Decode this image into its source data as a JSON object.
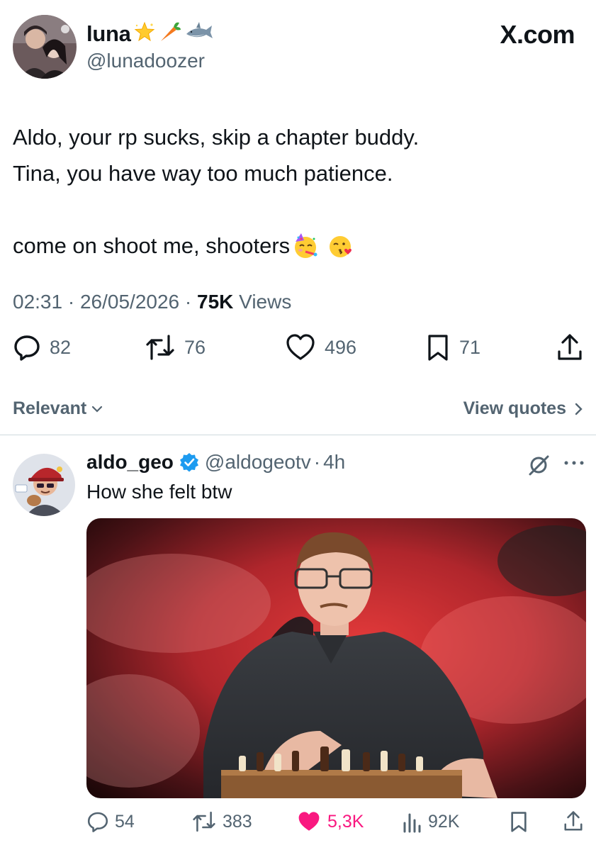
{
  "header": {
    "display_name": "luna",
    "name_emojis": [
      "star-emoji",
      "carrot-emoji",
      "shark-emoji"
    ],
    "handle": "@lunadoozer",
    "site": "X.com"
  },
  "tweet": {
    "lines": [
      "Aldo, your rp sucks, skip a chapter buddy.",
      "Tina, you have way too much patience.",
      "come on shoot me, shooters"
    ],
    "emojis": [
      "partying-face-emoji",
      "kissing-heart-emoji"
    ],
    "time": "02:31",
    "date": "26/05/2026",
    "views_count": "75K",
    "views_label": "Views",
    "sep": "·"
  },
  "actions": {
    "replies": "82",
    "reposts": "76",
    "likes": "496",
    "bookmarks": "71"
  },
  "sort": {
    "label": "Relevant",
    "view_quotes": "View quotes"
  },
  "reply": {
    "display_name": "aldo_geo",
    "verified": true,
    "handle": "@aldogeotv",
    "sep": "·",
    "age": "4h",
    "text": "How she felt btw",
    "actions": {
      "replies": "54",
      "reposts": "383",
      "likes": "5,3K",
      "views": "92K"
    }
  },
  "colors": {
    "text": "#0f1419",
    "secondary": "#536471",
    "like": "#f91880",
    "verified": "#1d9bf0",
    "divider": "#cfd9de"
  }
}
